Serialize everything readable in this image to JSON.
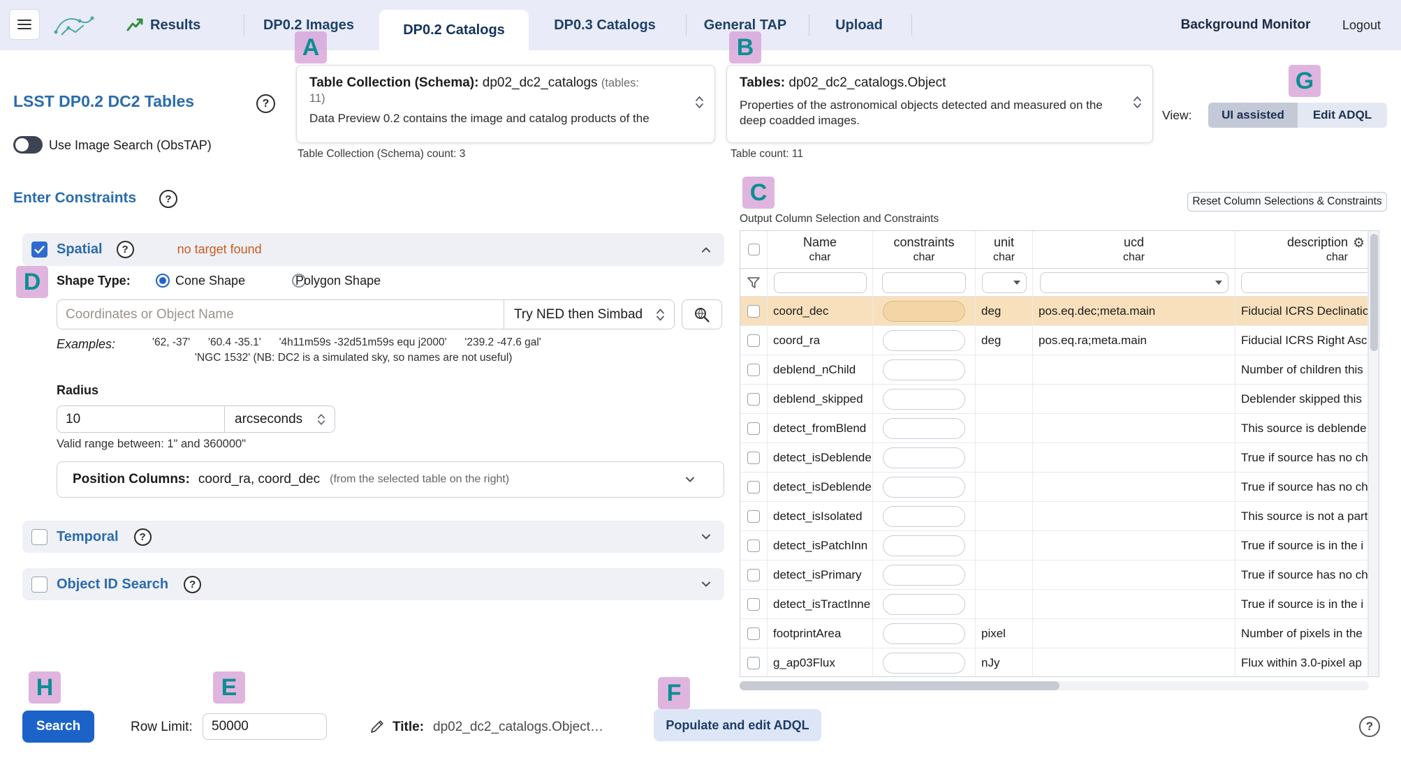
{
  "icons": {
    "help": "?",
    "gear": "⚙"
  },
  "annotations": {
    "a": "A",
    "b": "B",
    "c": "C",
    "d": "D",
    "e": "E",
    "f": "F",
    "g": "G",
    "h": "H"
  },
  "header": {
    "results": "Results",
    "tabs": {
      "images": "DP0.2 Images",
      "catalogs": "DP0.2 Catalogs",
      "dp03": "DP0.3 Catalogs",
      "tap": "General TAP",
      "upload": "Upload"
    },
    "background_monitor": "Background Monitor",
    "logout": "Logout"
  },
  "schema_panel": {
    "label": "Table Collection (Schema):",
    "value": "dp02_dc2_catalogs",
    "suffix1": "(tables:",
    "suffix2": "11)",
    "description": "Data Preview 0.2 contains the image and catalog products of the",
    "count": "Table Collection (Schema) count: 3"
  },
  "tables_panel": {
    "label": "Tables:",
    "value": "dp02_dc2_catalogs.Object",
    "description": "Properties of the astronomical objects detected and measured on the deep coadded images.",
    "count": "Table count: 11"
  },
  "view": {
    "label": "View:",
    "ui_assisted": "UI assisted",
    "edit_adql": "Edit ADQL"
  },
  "sidebar": {
    "title": "LSST DP0.2 DC2 Tables",
    "image_search_label": "Use Image Search (ObsTAP)",
    "enter_constraints": "Enter Constraints"
  },
  "spatial": {
    "label": "Spatial",
    "status": "no target found",
    "shape_type_label": "Shape Type:",
    "cone_label": "Cone Shape",
    "polygon_label": "Polygon Shape",
    "coords_placeholder": "Coordinates or Object Name",
    "resolver": "Try NED then Simbad",
    "examples_label": "Examples:",
    "examples_line1": "'62, -37'      '60.4 -35.1'      '4h11m59s -32d51m59s equ j2000'      '239.2 -47.6 gal'",
    "examples_line2": "'NGC 1532' (NB: DC2 is a simulated sky, so names are not useful)",
    "radius_label": "Radius",
    "radius_value": "10",
    "radius_unit": "arcseconds",
    "radius_hint": "Valid range between: 1\" and 360000\"",
    "position_label": "Position Columns:",
    "position_value": "coord_ra, coord_dec",
    "position_hint": "(from the selected table on the right)"
  },
  "temporal": {
    "label": "Temporal"
  },
  "object_id": {
    "label": "Object ID Search"
  },
  "columns_panel": {
    "reset_button": "Reset Column Selections & Constraints",
    "caption": "Output Column Selection and Constraints",
    "header_type": "char",
    "columns": {
      "name": "Name",
      "constraints": "constraints",
      "unit": "unit",
      "ucd": "ucd",
      "description": "description"
    }
  },
  "table": {
    "rows": [
      {
        "name": "coord_dec",
        "unit": "deg",
        "ucd": "pos.eq.dec;meta.main",
        "description": "Fiducial ICRS Declinatio",
        "highlighted": true
      },
      {
        "name": "coord_ra",
        "unit": "deg",
        "ucd": "pos.eq.ra;meta.main",
        "description": "Fiducial ICRS Right Asce",
        "highlighted": false
      },
      {
        "name": "deblend_nChild",
        "unit": "",
        "ucd": "",
        "description": "Number of children this",
        "highlighted": false
      },
      {
        "name": "deblend_skipped",
        "unit": "",
        "ucd": "",
        "description": "Deblender skipped this",
        "highlighted": false
      },
      {
        "name": "detect_fromBlend",
        "unit": "",
        "ucd": "",
        "description": "This source is deblende",
        "highlighted": false
      },
      {
        "name": "detect_isDeblende",
        "unit": "",
        "ucd": "",
        "description": "True if source has no ch",
        "highlighted": false
      },
      {
        "name": "detect_isDeblende",
        "unit": "",
        "ucd": "",
        "description": "True if source has no ch",
        "highlighted": false
      },
      {
        "name": "detect_isIsolated",
        "unit": "",
        "ucd": "",
        "description": "This source is not a part",
        "highlighted": false
      },
      {
        "name": "detect_isPatchInn",
        "unit": "",
        "ucd": "",
        "description": "True if source is in the i",
        "highlighted": false
      },
      {
        "name": "detect_isPrimary",
        "unit": "",
        "ucd": "",
        "description": "True if source has no ch",
        "highlighted": false
      },
      {
        "name": "detect_isTractInne",
        "unit": "",
        "ucd": "",
        "description": "True if source is in the i",
        "highlighted": false
      },
      {
        "name": "footprintArea",
        "unit": "pixel",
        "ucd": "",
        "description": "Number of pixels in the",
        "highlighted": false
      },
      {
        "name": "g_ap03Flux",
        "unit": "nJy",
        "ucd": "",
        "description": "Flux within 3.0-pixel ap",
        "highlighted": false
      }
    ]
  },
  "footer": {
    "search_button": "Search",
    "row_limit_label": "Row Limit:",
    "row_limit_value": "50000",
    "title_label": "Title:",
    "title_value": "dp02_dc2_catalogs.Object…",
    "populate_button": "Populate and edit ADQL"
  }
}
